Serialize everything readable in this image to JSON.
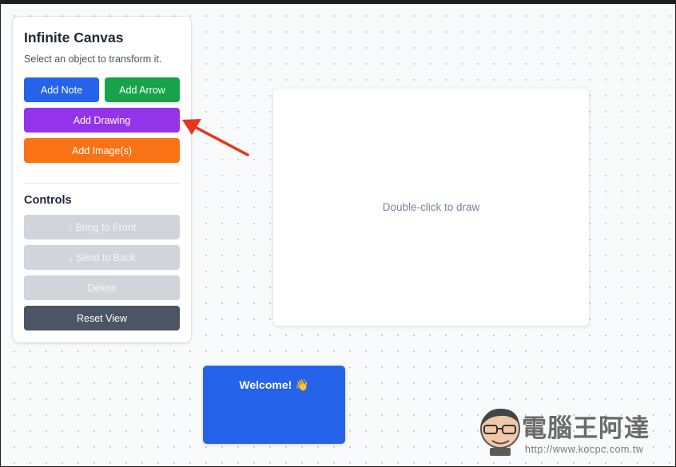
{
  "panel": {
    "title": "Infinite Canvas",
    "subtitle": "Select an object to transform it.",
    "buttons": {
      "add_note": "Add Note",
      "add_arrow": "Add Arrow",
      "add_drawing": "Add Drawing",
      "add_images": "Add Image(s)"
    },
    "controls_title": "Controls",
    "controls": {
      "bring_to_front": "↑ Bring to Front",
      "send_to_back": "↓ Send to Back",
      "delete": "Delete",
      "reset_view": "Reset View"
    }
  },
  "canvas": {
    "drawing_hint": "Double-click to draw",
    "note_text": "Welcome! 👋"
  },
  "watermark": {
    "text": "電腦王阿達",
    "url": "http://www.kocpc.com.tw"
  },
  "colors": {
    "note_blue": "#2563eb",
    "arrow_green": "#16a34a",
    "drawing_purple": "#9333ea",
    "image_orange": "#f97316",
    "disabled_gray": "#d1d5db",
    "reset_slate": "#4b5563",
    "annotation_red": "#e8341c"
  }
}
